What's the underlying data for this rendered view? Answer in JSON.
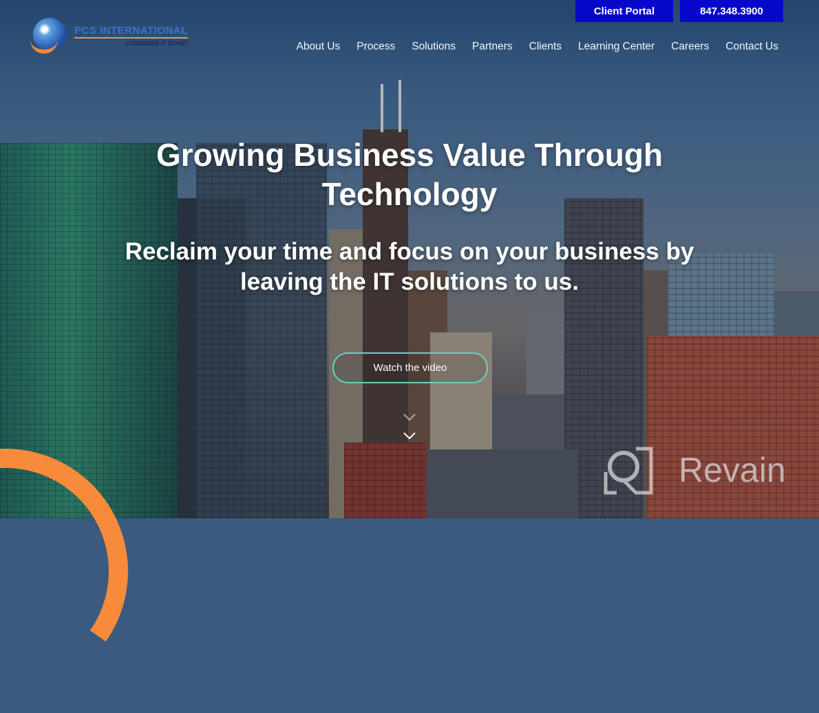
{
  "header": {
    "logo": {
      "name": "PCS INTERNATIONAL",
      "tagline": "CONSIDER IT DONE!"
    },
    "client_portal_label": "Client Portal",
    "phone_label": "847.348.3900",
    "nav": [
      {
        "label": "About Us"
      },
      {
        "label": "Process"
      },
      {
        "label": "Solutions"
      },
      {
        "label": "Partners"
      },
      {
        "label": "Clients"
      },
      {
        "label": "Learning Center"
      },
      {
        "label": "Careers"
      },
      {
        "label": "Contact Us"
      }
    ]
  },
  "hero": {
    "headline_line1": "Growing Business Value Through",
    "headline_line2": "Technology",
    "subline_line1": "Reclaim your time and focus on your business by",
    "subline_line2": "leaving the IT solutions to us.",
    "cta_label": "Watch the video",
    "scroll_icon": "chevron-down-icon"
  },
  "watermark": {
    "text": "Revain"
  },
  "colors": {
    "top_button_bg": "#0808cc",
    "cta_border": "#66d2c4",
    "accent_orange": "#f78b3a"
  }
}
